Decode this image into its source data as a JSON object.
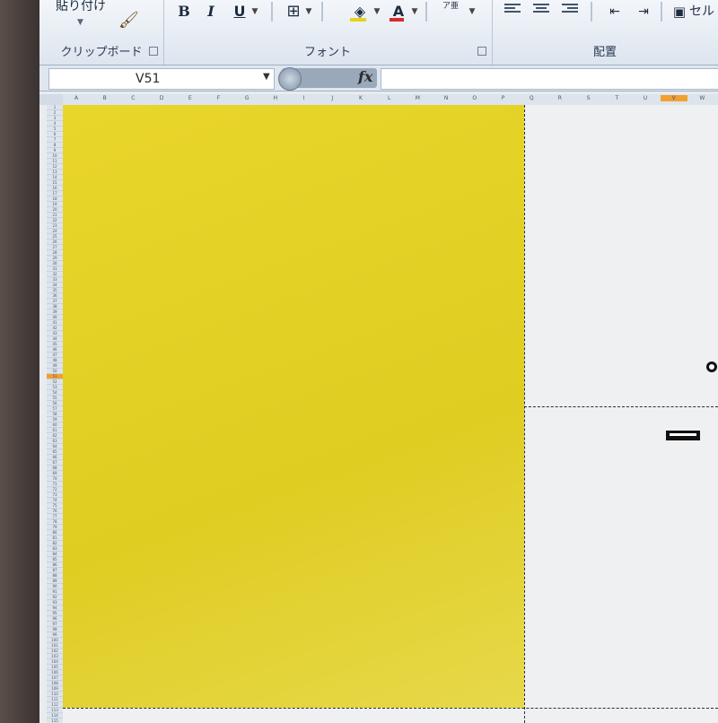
{
  "ribbon": {
    "clipboard": {
      "paste_label": "貼り付け",
      "group_label": "クリップボード"
    },
    "font": {
      "group_label": "フォント",
      "bold": "B",
      "italic": "I",
      "underline": "U",
      "font_color_letter": "A",
      "phonetic_letter": "ア亜",
      "fill_color": "#e8d319",
      "font_color": "#d42b2b"
    },
    "alignment": {
      "group_label": "配置",
      "cell_label_partial": "セル"
    }
  },
  "formula_bar": {
    "name_box": "V51",
    "fx_label": "fx",
    "formula": ""
  },
  "sheet": {
    "columns": [
      "A",
      "B",
      "C",
      "D",
      "E",
      "F",
      "G",
      "H",
      "I",
      "J",
      "K",
      "L",
      "M",
      "N",
      "O",
      "P",
      "Q",
      "R",
      "S",
      "T",
      "U",
      "V",
      "W"
    ],
    "selected_column": "V",
    "selected_row": "51",
    "fill_color": "#e3d22a"
  }
}
